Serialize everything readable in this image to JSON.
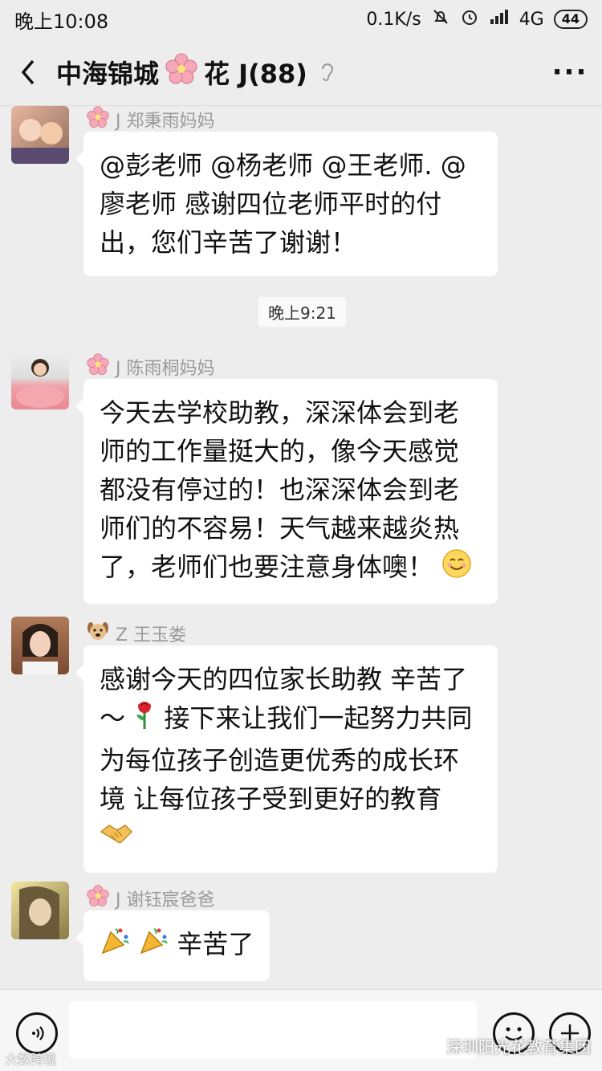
{
  "status": {
    "time": "晚上10:08",
    "speed": "0.1K/s",
    "network": "4G",
    "battery": "44"
  },
  "header": {
    "title": "中海锦城",
    "title_suffix": "花 J(88)"
  },
  "messages": [
    {
      "sender": "J 郑秉雨妈妈",
      "text": "@彭老师 @杨老师 @王老师. @廖老师  感谢四位老师平时的付出，您们辛苦了谢谢！"
    },
    {
      "timestamp": "晚上9:21"
    },
    {
      "sender": "J 陈雨桐妈妈",
      "text": "今天去学校助教，深深体会到老师的工作量挺大的，像今天感觉都没有停过的！也深深体会到老师们的不容易！天气越来越炎热了，老师们也要注意身体噢！"
    },
    {
      "sender": "Z 王玉娄",
      "text_a": "感谢今天的四位家长助教 辛苦了～",
      "text_b": "接下来让我们一起努力共同为每位孩子创造更优秀的成长环境 让每位孩子受到更好的教育"
    },
    {
      "sender": "J 谢钰宸爸爸",
      "text": "辛苦了"
    }
  ],
  "watermarks": {
    "left": "大数跨境",
    "right": "深圳阳光花教育集团"
  }
}
